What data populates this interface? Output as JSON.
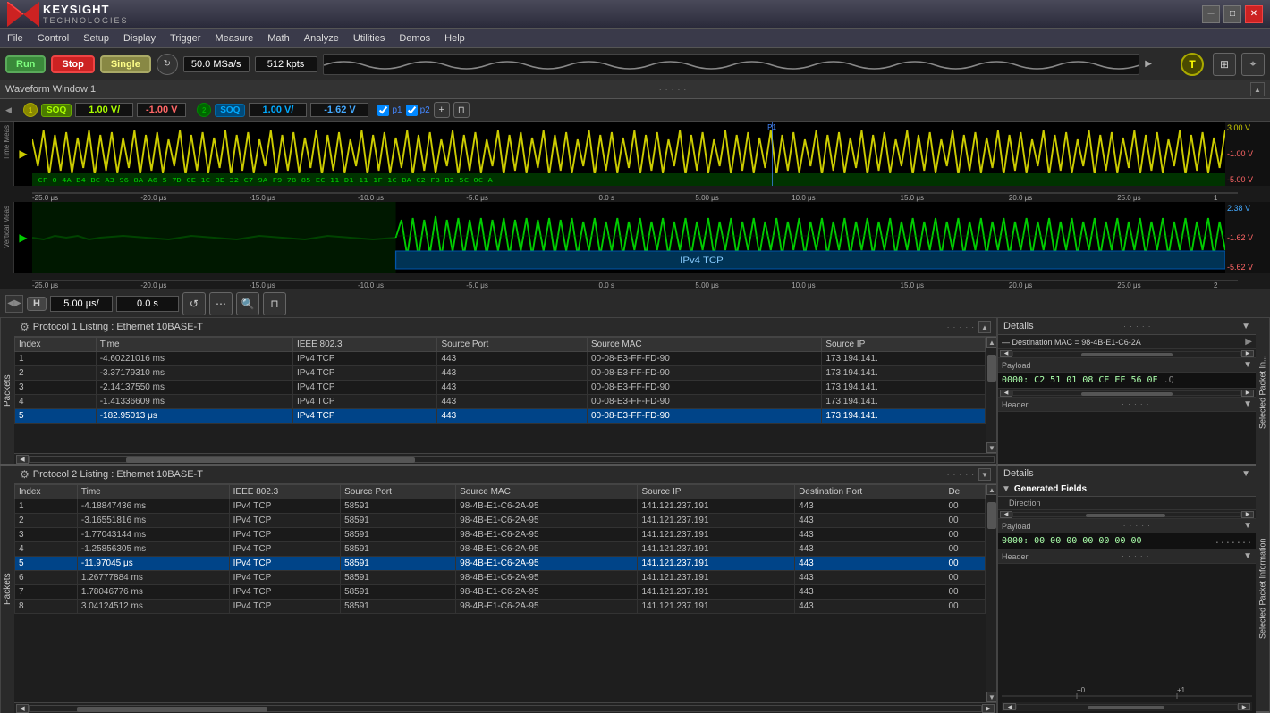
{
  "titlebar": {
    "title": "Keysight Technologies",
    "logo": "KEYSIGHT",
    "sub": "TECHNOLOGIES",
    "min_label": "─",
    "max_label": "□",
    "close_label": "✕"
  },
  "menubar": {
    "items": [
      "File",
      "Control",
      "Setup",
      "Display",
      "Trigger",
      "Measure",
      "Math",
      "Analyze",
      "Utilities",
      "Demos",
      "Help"
    ]
  },
  "toolbar": {
    "run_label": "Run",
    "stop_label": "Stop",
    "single_label": "Single",
    "sample_rate": "50.0 MSa/s",
    "memory": "512 kpts",
    "t_button": "T"
  },
  "waveform_window": {
    "title": "Waveform Window 1",
    "channel1": {
      "badge": "SOQ",
      "scale": "1.00 V/",
      "offset": "-1.00 V",
      "badge2": "SOQ",
      "scale2": "1.00 V/",
      "offset2": "-1.62 V",
      "p1_checked": true,
      "p2_checked": true
    },
    "scale_ch1": [
      "3.00 V",
      "-1.00 V",
      "-5.00 V"
    ],
    "scale_ch2": [
      "2.38 V",
      "-1.62 V",
      "-5.62 V"
    ],
    "protocol_label": "IPv4  TCP",
    "time_marks": [
      "-25.0 μs",
      "-20.0 μs",
      "-15.0 μs",
      "-10.0 μs",
      "-5.0 μs",
      "0.0 s",
      "5.00 μs",
      "10.0 μs",
      "15.0 μs",
      "20.0 μs",
      "25.0 μs"
    ],
    "h_scale": "5.00 μs/",
    "h_offset": "0.0 s"
  },
  "protocol1": {
    "title": "Protocol 1 Listing : Ethernet 10BASE-T",
    "columns": [
      "Index",
      "Time",
      "IEEE 802.3",
      "Source Port",
      "Source MAC",
      "Source IP"
    ],
    "rows": [
      {
        "index": "1",
        "time": "-4.60221016 ms",
        "ieee": "IPv4 TCP",
        "sport": "443",
        "smac": "00-08-E3-FF-FD-90",
        "sip": "173.194.141.",
        "selected": false
      },
      {
        "index": "2",
        "time": "-3.37179310 ms",
        "ieee": "IPv4 TCP",
        "sport": "443",
        "smac": "00-08-E3-FF-FD-90",
        "sip": "173.194.141.",
        "selected": false
      },
      {
        "index": "3",
        "time": "-2.14137550 ms",
        "ieee": "IPv4 TCP",
        "sport": "443",
        "smac": "00-08-E3-FF-FD-90",
        "sip": "173.194.141.",
        "selected": false
      },
      {
        "index": "4",
        "time": "-1.41336609 ms",
        "ieee": "IPv4 TCP",
        "sport": "443",
        "smac": "00-08-E3-FF-FD-90",
        "sip": "173.194.141.",
        "selected": false
      },
      {
        "index": "5",
        "time": "-182.95013 μs",
        "ieee": "IPv4 TCP",
        "sport": "443",
        "smac": "00-08-E3-FF-FD-90",
        "sip": "173.194.141.",
        "selected": true
      }
    ],
    "details": {
      "title": "Details",
      "dest_mac": "Destination MAC = 98-4B-E1-C6-2A",
      "payload_label": "Payload",
      "payload_hex": "0000:  C2 51 01 08 CE EE 56 0E",
      "header_label": "Header"
    }
  },
  "protocol2": {
    "title": "Protocol 2 Listing : Ethernet 10BASE-T",
    "columns": [
      "Index",
      "Time",
      "IEEE 802.3",
      "Source Port",
      "Source MAC",
      "Source IP",
      "Destination Port",
      "De"
    ],
    "rows": [
      {
        "index": "1",
        "time": "-4.18847436 ms",
        "ieee": "IPv4 TCP",
        "sport": "58591",
        "smac": "98-4B-E1-C6-2A-95",
        "sip": "141.121.237.191",
        "dport": "443",
        "de": "00",
        "selected": false
      },
      {
        "index": "2",
        "time": "-3.16551816 ms",
        "ieee": "IPv4 TCP",
        "sport": "58591",
        "smac": "98-4B-E1-C6-2A-95",
        "sip": "141.121.237.191",
        "dport": "443",
        "de": "00",
        "selected": false
      },
      {
        "index": "3",
        "time": "-1.77043144 ms",
        "ieee": "IPv4 TCP",
        "sport": "58591",
        "smac": "98-4B-E1-C6-2A-95",
        "sip": "141.121.237.191",
        "dport": "443",
        "de": "00",
        "selected": false
      },
      {
        "index": "4",
        "time": "-1.25856305 ms",
        "ieee": "IPv4 TCP",
        "sport": "58591",
        "smac": "98-4B-E1-C6-2A-95",
        "sip": "141.121.237.191",
        "dport": "443",
        "de": "00",
        "selected": false
      },
      {
        "index": "5",
        "time": "-11.97045 μs",
        "ieee": "IPv4 TCP",
        "sport": "58591",
        "smac": "98-4B-E1-C6-2A-95",
        "sip": "141.121.237.191",
        "dport": "443",
        "de": "00",
        "selected": true
      },
      {
        "index": "6",
        "time": "1.26777884 ms",
        "ieee": "IPv4 TCP",
        "sport": "58591",
        "smac": "98-4B-E1-C6-2A-95",
        "sip": "141.121.237.191",
        "dport": "443",
        "de": "00",
        "selected": false
      },
      {
        "index": "7",
        "time": "1.78046776 ms",
        "ieee": "IPv4 TCP",
        "sport": "58591",
        "smac": "98-4B-E1-C6-2A-95",
        "sip": "141.121.237.191",
        "dport": "443",
        "de": "00",
        "selected": false
      },
      {
        "index": "8",
        "time": "3.04124512 ms",
        "ieee": "IPv4 TCP",
        "sport": "58591",
        "smac": "98-4B-E1-C6-2A-95",
        "sip": "141.121.237.191",
        "dport": "443",
        "de": "00",
        "selected": false
      }
    ],
    "details": {
      "title": "Details",
      "generated_fields_label": "Generated Fields",
      "direction_label": "Direction",
      "payload_label": "Payload",
      "payload_hex": "0000:  00 00 00 00 00 00 00",
      "payload_dots": ".......",
      "header_label": "Header",
      "scroll_plus": "+0",
      "scroll_minus": "+1"
    }
  }
}
